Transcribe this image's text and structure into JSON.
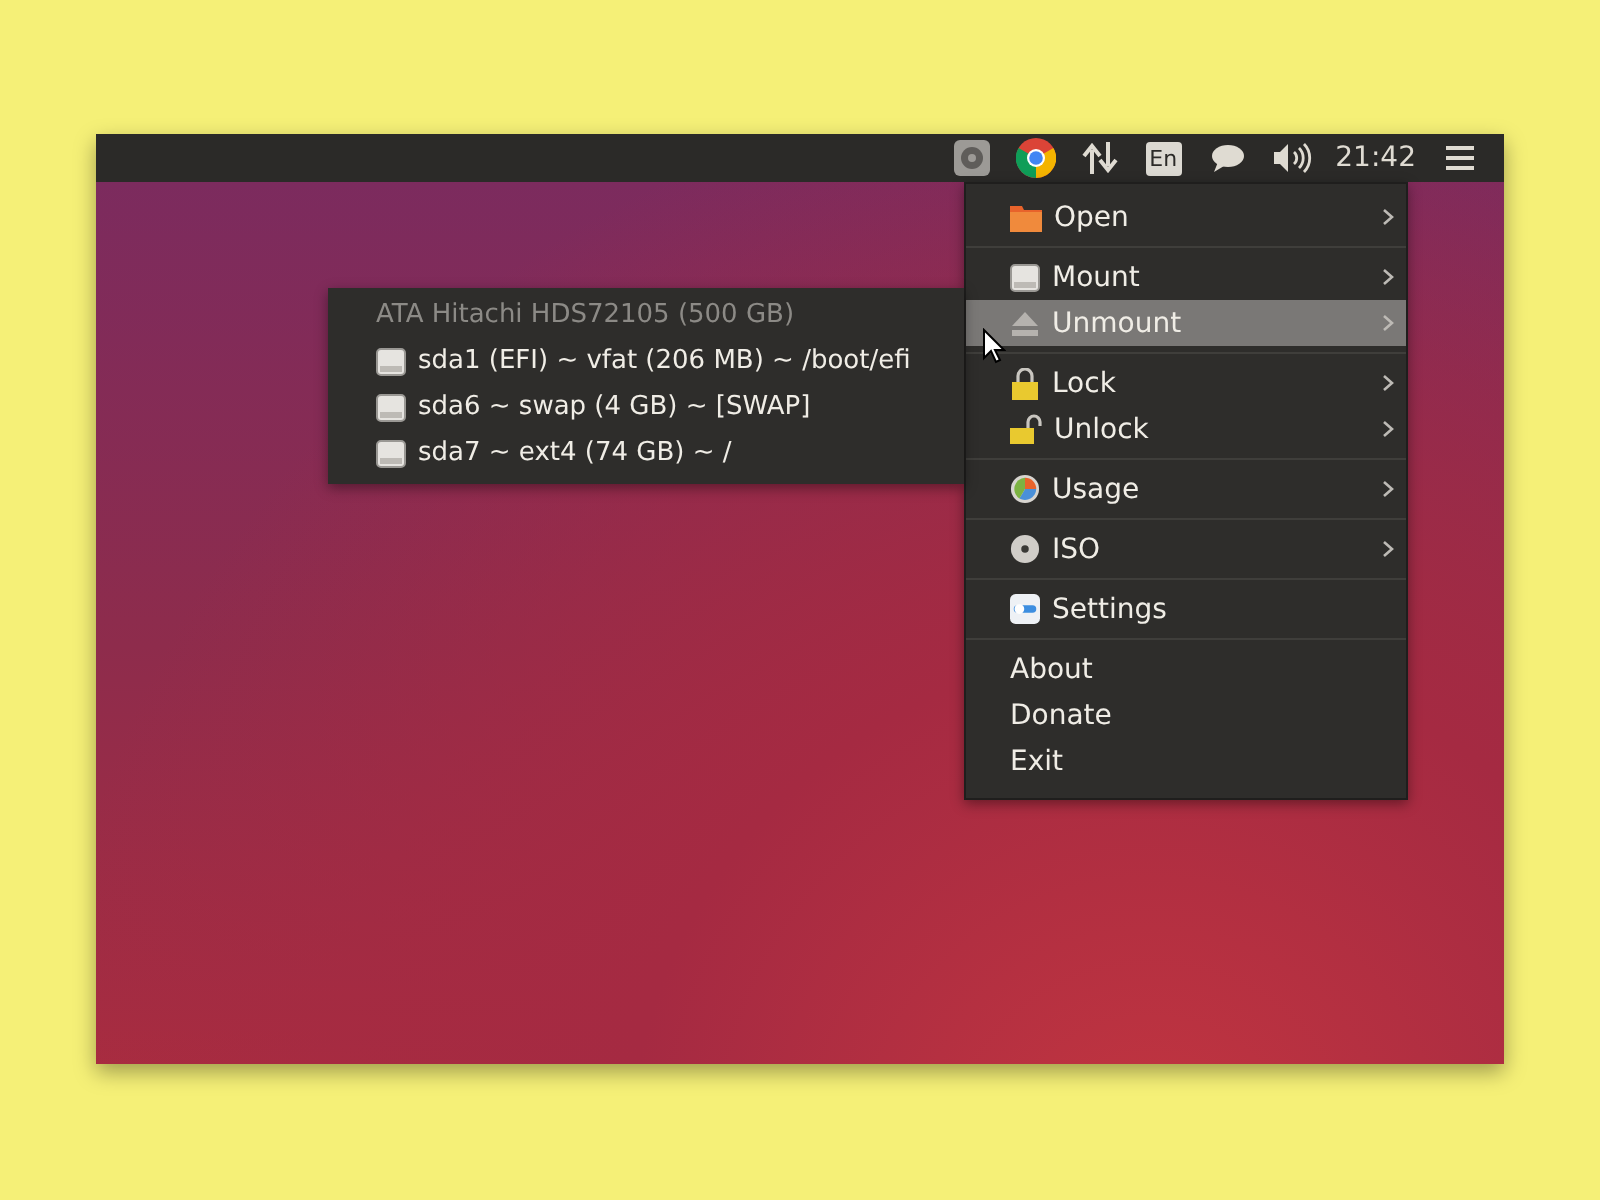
{
  "panel": {
    "indicators": [
      {
        "kind": "disk"
      },
      {
        "kind": "browser"
      },
      {
        "kind": "network"
      },
      {
        "kind": "keyboard",
        "label": "En"
      },
      {
        "kind": "chat"
      },
      {
        "kind": "sound"
      },
      {
        "kind": "clock",
        "label": "21:42"
      },
      {
        "kind": "menu"
      }
    ]
  },
  "menu": {
    "groups": [
      {
        "items": [
          {
            "kind": "folder",
            "label": "Open",
            "submenu": true,
            "selected": false
          }
        ]
      },
      {
        "items": [
          {
            "kind": "drive",
            "label": "Mount",
            "submenu": true,
            "selected": false
          },
          {
            "kind": "eject",
            "label": "Unmount",
            "submenu": true,
            "selected": true
          }
        ]
      },
      {
        "items": [
          {
            "kind": "lock",
            "label": "Lock",
            "submenu": true,
            "selected": false
          },
          {
            "kind": "unlock",
            "label": "Unlock",
            "submenu": true,
            "selected": false
          }
        ]
      },
      {
        "items": [
          {
            "kind": "pie",
            "label": "Usage",
            "submenu": true,
            "selected": false
          }
        ]
      },
      {
        "items": [
          {
            "kind": "disc",
            "label": "ISO",
            "submenu": true,
            "selected": false
          }
        ]
      },
      {
        "items": [
          {
            "kind": "toggle",
            "label": "Settings",
            "submenu": false,
            "selected": false
          }
        ]
      },
      {
        "items": [
          {
            "kind": "plain",
            "label": "About",
            "submenu": false,
            "selected": false
          },
          {
            "kind": "plain",
            "label": "Donate",
            "submenu": false,
            "selected": false
          },
          {
            "kind": "plain",
            "label": "Exit",
            "submenu": false,
            "selected": false
          }
        ]
      }
    ]
  },
  "submenu": {
    "items": [
      {
        "label": "ATA Hitachi HDS72105 (500 GB)",
        "disabled": true,
        "icon": false
      },
      {
        "label": "sda1 (EFI) ~ vfat (206 MB) ~ /boot/efi",
        "disabled": false,
        "icon": true
      },
      {
        "label": "sda6 ~ swap (4 GB) ~ [SWAP]",
        "disabled": false,
        "icon": true
      },
      {
        "label": "sda7 ~ ext4 (74 GB) ~ /",
        "disabled": false,
        "icon": true
      }
    ]
  }
}
